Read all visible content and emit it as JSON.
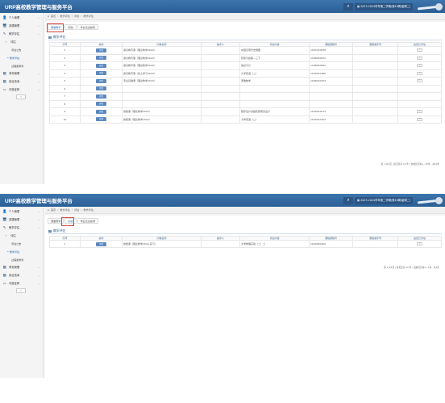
{
  "app": {
    "title": "URP高校教学管理与服务平台",
    "term": "2023-2024学年第二学期(第16周/星期二)"
  },
  "sidebar": {
    "items": [
      {
        "key": "personal",
        "label": "个人管理",
        "icon": "person-icon",
        "glyph": "👤"
      },
      {
        "key": "elective",
        "label": "选课管理",
        "icon": "monitor-icon",
        "glyph": "🖥"
      },
      {
        "key": "teaching-eval",
        "label": "教学评估",
        "icon": "pencil-icon",
        "glyph": "✎"
      },
      {
        "key": "eval",
        "label": "评估",
        "icon": "chevron-icon",
        "glyph": "›"
      },
      {
        "key": "exam",
        "label": "考务管理",
        "icon": "calendar-icon",
        "glyph": "▦"
      },
      {
        "key": "comprehensive",
        "label": "综合查询",
        "icon": "calendar-icon",
        "glyph": "▦"
      },
      {
        "key": "internship",
        "label": "可邀证研",
        "icon": "card-icon",
        "glyph": "▭"
      }
    ],
    "subitems": [
      "评估公告",
      "教学评估",
      "过程类附件"
    ],
    "collapse_glyph": "«"
  },
  "breadcrumb": {
    "home_icon": "home-icon",
    "home": "首页",
    "items": [
      "教学评估",
      "评估",
      "教学评估"
    ]
  },
  "tabs": [
    "课堂教学",
    "实验",
    "毕业论文指导"
  ],
  "section_title": "教学评估",
  "panels": [
    {
      "active_tab": 0,
      "columns": [
        "序号",
        "操作",
        "问卷名称",
        "被评人",
        "评估内容",
        "课程课程号",
        "课程课序号",
        "是否已评估"
      ],
      "rows": [
        {
          "no": "1",
          "action": "评估",
          "name": "通识教育课（理论教学2024）",
          "person": "",
          "content": "中国近现代史纲要",
          "course": "1007010838",
          "seq": "",
          "done": "否"
        },
        {
          "no": "2",
          "action": "评估",
          "name": "通识教育课（理论教学2024）",
          "person": "",
          "content": "形势与政策—三下",
          "course": "1046020002",
          "seq": "",
          "done": "否"
        },
        {
          "no": "3",
          "action": "评估",
          "name": "通识教育课（理论教学2024）",
          "person": "",
          "content": "信息与计",
          "course": "1046020002",
          "seq": "",
          "done": "否"
        },
        {
          "no": "4",
          "action": "评估",
          "name": "通识教育课（线上学习2024）",
          "person": "",
          "content": "大学英语（二）",
          "course": "1042010380",
          "seq": "",
          "done": "否"
        },
        {
          "no": "5",
          "action": "评估",
          "name": "专业基础课（理论教学2024）",
          "person": "",
          "content": "离散数学",
          "course": "1046010303",
          "seq": "",
          "done": "否"
        },
        {
          "no": "6",
          "action": "评估",
          "name": "",
          "person": "",
          "content": "",
          "course": "",
          "seq": "",
          "done": ""
        },
        {
          "no": "7",
          "action": "评估",
          "name": "",
          "person": "",
          "content": "",
          "course": "",
          "seq": "",
          "done": ""
        },
        {
          "no": "8",
          "action": "评估",
          "name": "",
          "person": "",
          "content": "",
          "course": "",
          "seq": "",
          "done": ""
        },
        {
          "no": "9",
          "action": "评估",
          "name": "技能课（理论教学2024）",
          "person": "",
          "content": "程序设计基础实践项目设计",
          "course": "1044010013",
          "seq": "",
          "done": "否"
        },
        {
          "no": "10",
          "action": "评估",
          "name": "技能课（理论教学2024）",
          "person": "",
          "content": "大学英语（二）",
          "course": "1044010303",
          "seq": "",
          "done": "否"
        }
      ],
      "pager": "第 1 共1页 | 每页显示 10 条 | 当前显示第1—10条，共10条"
    },
    {
      "active_tab": 1,
      "columns": [
        "序号",
        "操作",
        "问卷名称",
        "被评人",
        "评估内容",
        "课程课程号",
        "课程课序号",
        "是否已评估"
      ],
      "rows": [
        {
          "no": "1",
          "action": "评估",
          "name": "技能课（理论教学2024-实习）",
          "person": "",
          "content": "大学物理实验（二）上",
          "course": "1044030300",
          "seq": "",
          "done": "否"
        }
      ],
      "pager": "第 1 共1页 | 每页显示 10 条 | 当前显示第1—1条，共1条"
    }
  ],
  "colors": {
    "topbar": "#2b5f95",
    "accent": "#2b6cb0",
    "highlight_box": "#d5433a",
    "eval_button": "#5b88bf"
  }
}
